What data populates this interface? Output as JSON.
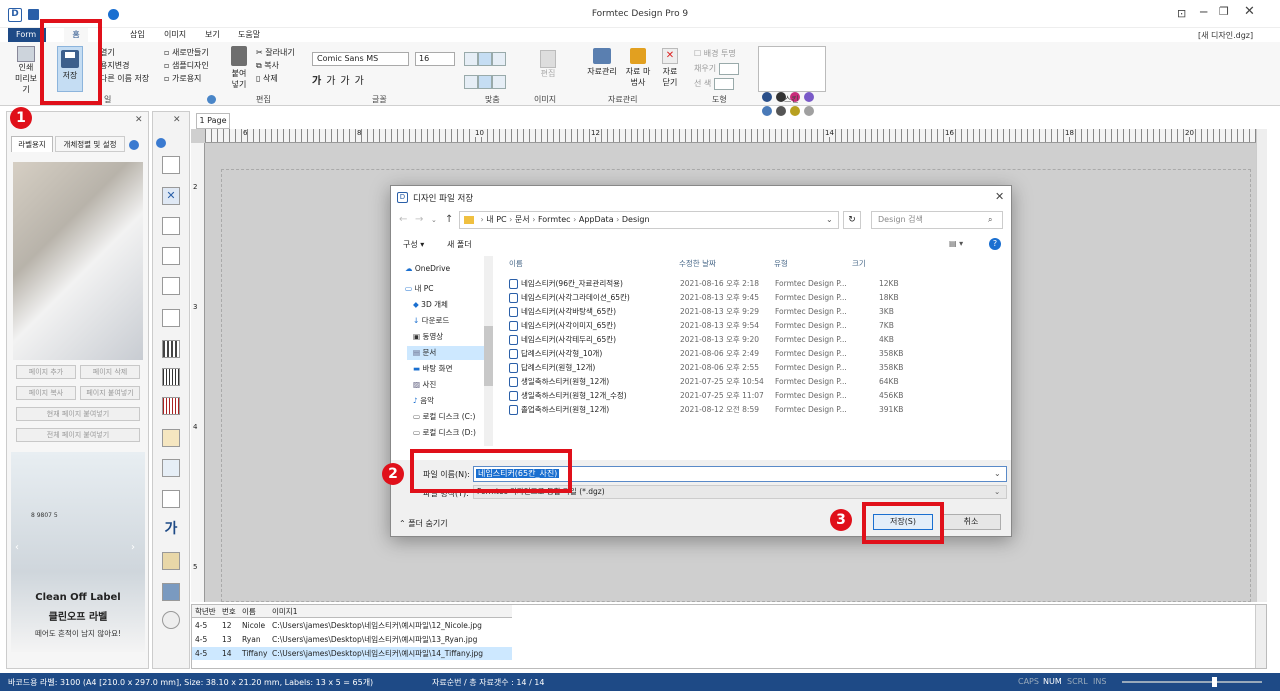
{
  "app": {
    "title": "Formtec Design Pro 9",
    "doc_name": "[새 디자인.dgz]"
  },
  "tabs": [
    "Form",
    "홈",
    "삽입",
    "이미지",
    "보기",
    "도움말"
  ],
  "ribbon": {
    "print_preview": [
      "인쇄",
      "미리보기"
    ],
    "save_label": "저장",
    "file_items": [
      "열기",
      "용지변경",
      "다른 이름 저장"
    ],
    "new_items": [
      "새로만들기",
      "샘플디자인",
      "가로용지"
    ],
    "paste_label": "붙여넣기",
    "edit_items": [
      "잘라내기",
      "복사",
      "삭제"
    ],
    "edit_group": "편집",
    "font_name": "Comic Sans MS",
    "font_size": "16",
    "font_group": "글꼴",
    "align_group": "맞춤",
    "image_label": "편집",
    "image_group": "이미지",
    "data_items": [
      "자료관리",
      "자료 마법사",
      "자료 닫기"
    ],
    "data_group": "자료관리",
    "shape_items": [
      "배경 투명",
      "채우기",
      "선 색"
    ],
    "shape_group": "도형",
    "skin_group": "스킨",
    "file_group_suffix": "일"
  },
  "left_panel": {
    "tabs": [
      "라벨용지",
      "개체정렬 및 설정"
    ],
    "page_buttons": [
      "페이지 추가",
      "페이지 삭제",
      "페이지 복사",
      "페이지 붙여넣기",
      "현재 페이지 붙여넣기",
      "전체 페이지 붙여넣기"
    ],
    "ad_brand": "Clean Off Label",
    "ad_title": "클린오프 라벨",
    "ad_sub": "떼어도 흔적이 남지 않아요!",
    "ad_code": "8 9807 5"
  },
  "canvas": {
    "page_tab": "1 Page",
    "ruler_marks": [
      "6",
      "8",
      "10",
      "12",
      "14",
      "16",
      "18",
      "20"
    ],
    "v_ruler": [
      "2",
      "3",
      "4",
      "5"
    ]
  },
  "dialog": {
    "title": "디자인 파일 저장",
    "path": [
      "내 PC",
      "문서",
      "Formtec",
      "AppData",
      "Design"
    ],
    "search_placeholder": "Design 검색",
    "organize": "구성",
    "new_folder": "새 폴더",
    "nav": [
      "OneDrive",
      "내 PC",
      "3D 개체",
      "다운로드",
      "동영상",
      "문서",
      "바탕 화면",
      "사진",
      "음악",
      "로컬 디스크 (C:)",
      "로컬 디스크 (D:)"
    ],
    "columns": [
      "이름",
      "수정한 날짜",
      "유형",
      "크기"
    ],
    "files": [
      {
        "name": "네임스티커(96칸_자료관리적용)",
        "date": "2021-08-16 오후 2:18",
        "type": "Formtec Design P...",
        "size": "12KB"
      },
      {
        "name": "네임스티커(사각그라데이션_65칸)",
        "date": "2021-08-13 오후 9:45",
        "type": "Formtec Design P...",
        "size": "18KB"
      },
      {
        "name": "네임스티커(사각바탕색_65칸)",
        "date": "2021-08-13 오후 9:29",
        "type": "Formtec Design P...",
        "size": "3KB"
      },
      {
        "name": "네임스티커(사각이미지_65칸)",
        "date": "2021-08-13 오후 9:54",
        "type": "Formtec Design P...",
        "size": "7KB"
      },
      {
        "name": "네임스티커(사각테두리_65칸)",
        "date": "2021-08-13 오후 9:20",
        "type": "Formtec Design P...",
        "size": "4KB"
      },
      {
        "name": "답례스티커(사각형_10개)",
        "date": "2021-08-06 오후 2:49",
        "type": "Formtec Design P...",
        "size": "358KB"
      },
      {
        "name": "답례스티커(원형_12개)",
        "date": "2021-08-06 오후 2:55",
        "type": "Formtec Design P...",
        "size": "358KB"
      },
      {
        "name": "생일축하스티커(원형_12개)",
        "date": "2021-07-25 오후 10:54",
        "type": "Formtec Design P...",
        "size": "64KB"
      },
      {
        "name": "생일축하스티커(원형_12개_수정)",
        "date": "2021-07-25 오후 11:07",
        "type": "Formtec Design P...",
        "size": "456KB"
      },
      {
        "name": "졸업축하스티커(원형_12개)",
        "date": "2021-08-12 오전 8:59",
        "type": "Formtec Design P...",
        "size": "391KB"
      }
    ],
    "filename_label": "파일 이름(N):",
    "filename_value": "네임스티커(65칸_사진)",
    "filetype_label": "파일 형식(T):",
    "filetype_value": "Formtec 디자인프로 통합 파일 (*.dgz)",
    "hide_folders": "폴더 숨기기",
    "save_button": "저장(S)",
    "cancel_button": "취소"
  },
  "grid": {
    "headers": [
      "학년반",
      "번호",
      "이름",
      "이미지1"
    ],
    "rows": [
      [
        "4-5",
        "12",
        "Nicole",
        "C:\\Users\\james\\Desktop\\네임스티커\\예시파일\\12_Nicole.jpg"
      ],
      [
        "4-5",
        "13",
        "Ryan",
        "C:\\Users\\james\\Desktop\\네임스티커\\예시파일\\13_Ryan.jpg"
      ],
      [
        "4-5",
        "14",
        "Tiffany",
        "C:\\Users\\james\\Desktop\\네임스티커\\예시파일\\14_Tiffany.jpg"
      ]
    ]
  },
  "status": {
    "label_info": "바코드용 라벨: 3100 (A4 [210.0 x 297.0 mm], Size: 38.10 x 21.20 mm, Labels: 13 x 5 = 65개)",
    "record_info": "자료순번 / 총 자료갯수 : 14 / 14",
    "keys": [
      "CAPS",
      "NUM",
      "SCRL",
      "INS"
    ]
  },
  "steps": [
    "1",
    "2",
    "3"
  ],
  "colors": {
    "accent": "#1e4a86",
    "highlight": "#e0101a",
    "selection": "#cde8ff"
  }
}
